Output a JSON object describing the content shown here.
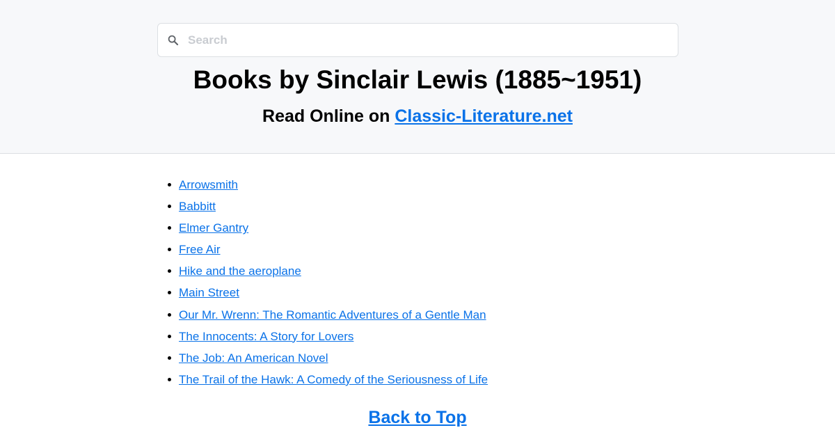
{
  "search": {
    "placeholder": "Search",
    "icon": "search-icon"
  },
  "header": {
    "title": "Books by Sinclair Lewis (1885~1951)",
    "subtitle_prefix": "Read Online on ",
    "site_link": "Classic-Literature.net"
  },
  "books": [
    "Arrowsmith",
    "Babbitt",
    "Elmer Gantry",
    "Free Air",
    "Hike and the aeroplane",
    "Main Street",
    "Our Mr. Wrenn: The Romantic Adventures of a Gentle Man",
    "The Innocents: A Story for Lovers",
    "The Job: An American Novel",
    "The Trail of the Hawk: A Comedy of the Seriousness of Life"
  ],
  "footer": {
    "back_to_top": "Back to Top"
  },
  "colors": {
    "link": "#0a72e8",
    "header_bg": "#f7f8fa",
    "border": "#dcdfe3"
  }
}
